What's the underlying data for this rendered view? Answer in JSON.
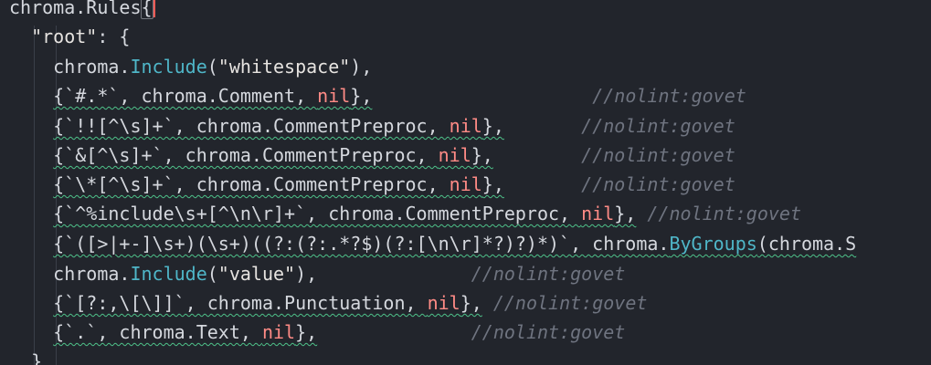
{
  "colors": {
    "background": "#22252c",
    "text": "#d5d8de",
    "function": "#4fb6c8",
    "string": "#e6e3e0",
    "nil": "#ff8b86",
    "comment": "#6f7480",
    "squiggle": "#4ec28a",
    "caret": "#ff5a55"
  },
  "lines": [
    {
      "tokens": [
        {
          "text": "chroma.Rules",
          "type": "plain"
        },
        {
          "text": "{",
          "type": "bracket",
          "cursor": true
        }
      ],
      "caret": true
    },
    {
      "tokens": [
        {
          "text": "  ",
          "type": "plain"
        },
        {
          "text": "\"root\"",
          "type": "str"
        },
        {
          "text": ": {",
          "type": "plain"
        }
      ]
    },
    {
      "tokens": [
        {
          "text": "    chroma.",
          "type": "plain"
        },
        {
          "text": "Include",
          "type": "fn"
        },
        {
          "text": "(",
          "type": "plain"
        },
        {
          "text": "\"whitespace\"",
          "type": "str"
        },
        {
          "text": "),",
          "type": "plain"
        }
      ]
    },
    {
      "tokens": [
        {
          "text": "    ",
          "type": "plain"
        },
        {
          "text": "{`#.*`, chroma.Comment, ",
          "type": "plain",
          "squiggle": true
        },
        {
          "text": "nil",
          "type": "nil",
          "squiggle": true
        },
        {
          "text": "},",
          "type": "plain",
          "squiggle": true
        },
        {
          "text": "                    ",
          "type": "plain"
        },
        {
          "text": "//nolint:govet",
          "type": "comment"
        }
      ]
    },
    {
      "tokens": [
        {
          "text": "    ",
          "type": "plain"
        },
        {
          "text": "{`!![^\\s]+`, chroma.CommentPreproc, ",
          "type": "plain",
          "squiggle": true
        },
        {
          "text": "nil",
          "type": "nil",
          "squiggle": true
        },
        {
          "text": "},",
          "type": "plain",
          "squiggle": true
        },
        {
          "text": "       ",
          "type": "plain"
        },
        {
          "text": "//nolint:govet",
          "type": "comment"
        }
      ]
    },
    {
      "tokens": [
        {
          "text": "    ",
          "type": "plain"
        },
        {
          "text": "{`&[^\\s]+`, chroma.CommentPreproc, ",
          "type": "plain",
          "squiggle": true
        },
        {
          "text": "nil",
          "type": "nil",
          "squiggle": true
        },
        {
          "text": "},",
          "type": "plain",
          "squiggle": true
        },
        {
          "text": "        ",
          "type": "plain"
        },
        {
          "text": "//nolint:govet",
          "type": "comment"
        }
      ]
    },
    {
      "tokens": [
        {
          "text": "    ",
          "type": "plain"
        },
        {
          "text": "{`\\*[^\\s]+`, chroma.CommentPreproc, ",
          "type": "plain",
          "squiggle": true
        },
        {
          "text": "nil",
          "type": "nil",
          "squiggle": true
        },
        {
          "text": "},",
          "type": "plain",
          "squiggle": true
        },
        {
          "text": "       ",
          "type": "plain"
        },
        {
          "text": "//nolint:govet",
          "type": "comment"
        }
      ]
    },
    {
      "tokens": [
        {
          "text": "    ",
          "type": "plain"
        },
        {
          "text": "{`^%include\\s+[^\\n\\r]+`, chroma.CommentPreproc, ",
          "type": "plain",
          "squiggle": true
        },
        {
          "text": "nil",
          "type": "nil",
          "squiggle": true
        },
        {
          "text": "},",
          "type": "plain",
          "squiggle": true
        },
        {
          "text": " ",
          "type": "plain"
        },
        {
          "text": "//nolint:govet",
          "type": "comment"
        }
      ]
    },
    {
      "tokens": [
        {
          "text": "    ",
          "type": "plain"
        },
        {
          "text": "{`([>|+-]\\s+)(\\s+)((?:(?:.*?$)(?:[\\n\\r]*?)?)*)`, chroma.",
          "type": "plain",
          "squiggle": true
        },
        {
          "text": "ByGroups",
          "type": "fn",
          "squiggle": true
        },
        {
          "text": "(chroma.S",
          "type": "plain",
          "squiggle": true
        }
      ]
    },
    {
      "tokens": [
        {
          "text": "    chroma.",
          "type": "plain"
        },
        {
          "text": "Include",
          "type": "fn"
        },
        {
          "text": "(",
          "type": "plain"
        },
        {
          "text": "\"value\"",
          "type": "str"
        },
        {
          "text": "),",
          "type": "plain"
        },
        {
          "text": "              ",
          "type": "plain"
        },
        {
          "text": "//nolint:govet",
          "type": "comment"
        }
      ]
    },
    {
      "tokens": [
        {
          "text": "    ",
          "type": "plain"
        },
        {
          "text": "{`[?:,\\[\\]]`, chroma.Punctuation, ",
          "type": "plain",
          "squiggle": true
        },
        {
          "text": "nil",
          "type": "nil",
          "squiggle": true
        },
        {
          "text": "},",
          "type": "plain",
          "squiggle": true
        },
        {
          "text": " ",
          "type": "plain"
        },
        {
          "text": "//nolint:govet",
          "type": "comment"
        }
      ]
    },
    {
      "tokens": [
        {
          "text": "    ",
          "type": "plain"
        },
        {
          "text": "{`.`, chroma.Text, ",
          "type": "plain",
          "squiggle": true
        },
        {
          "text": "nil",
          "type": "nil",
          "squiggle": true
        },
        {
          "text": "},",
          "type": "plain",
          "squiggle": true
        },
        {
          "text": "              ",
          "type": "plain"
        },
        {
          "text": "//nolint:govet",
          "type": "comment"
        }
      ]
    },
    {
      "tokens": [
        {
          "text": "  },",
          "type": "plain"
        }
      ]
    }
  ]
}
